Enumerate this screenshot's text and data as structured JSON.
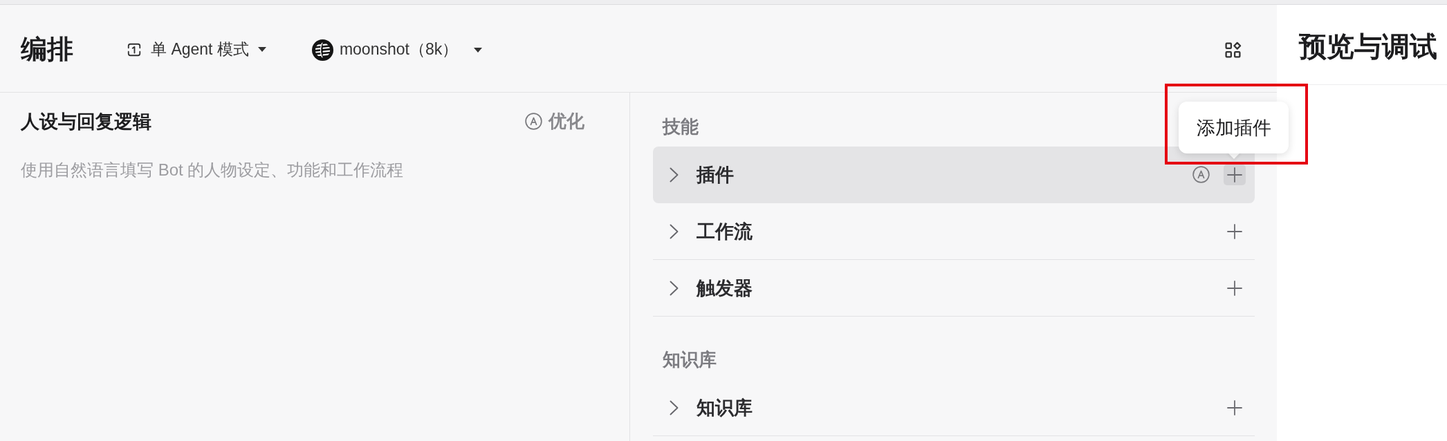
{
  "header": {
    "title": "编排",
    "mode": "单 Agent 模式",
    "model": "moonshot（8k）"
  },
  "persona": {
    "title": "人设与回复逻辑",
    "optimize": "优化",
    "placeholder": "使用自然语言填写 Bot 的人物设定、功能和工作流程"
  },
  "sections": [
    {
      "title": "技能",
      "items": [
        {
          "label": "插件",
          "expanded": false,
          "hovered": true
        },
        {
          "label": "工作流",
          "expanded": false,
          "hovered": false
        },
        {
          "label": "触发器",
          "expanded": false,
          "hovered": false
        }
      ]
    },
    {
      "title": "知识库",
      "items": [
        {
          "label": "知识库",
          "expanded": false,
          "hovered": false
        }
      ]
    }
  ],
  "tooltip": {
    "text": "添加插件",
    "highlighted": true
  },
  "preview": {
    "title": "预览与调试"
  }
}
